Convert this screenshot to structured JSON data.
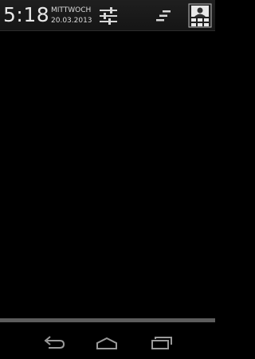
{
  "status_header": {
    "time": "5:18",
    "weekday": "MITTWOCH",
    "date": "20.03.2013"
  },
  "icons": {
    "settings": "sliders-icon",
    "clear_all": "clear-notifications-icon",
    "profile": "user-profile-icon"
  },
  "navigation": {
    "back": "back-arrow-icon",
    "home": "home-icon",
    "recents": "recent-apps-icon"
  },
  "colors": {
    "background": "#000000",
    "header": "#1f1f1f",
    "icon": "#d8d8d8",
    "nav_icon": "#9a9a9a",
    "handle": "#5c5c5c"
  }
}
